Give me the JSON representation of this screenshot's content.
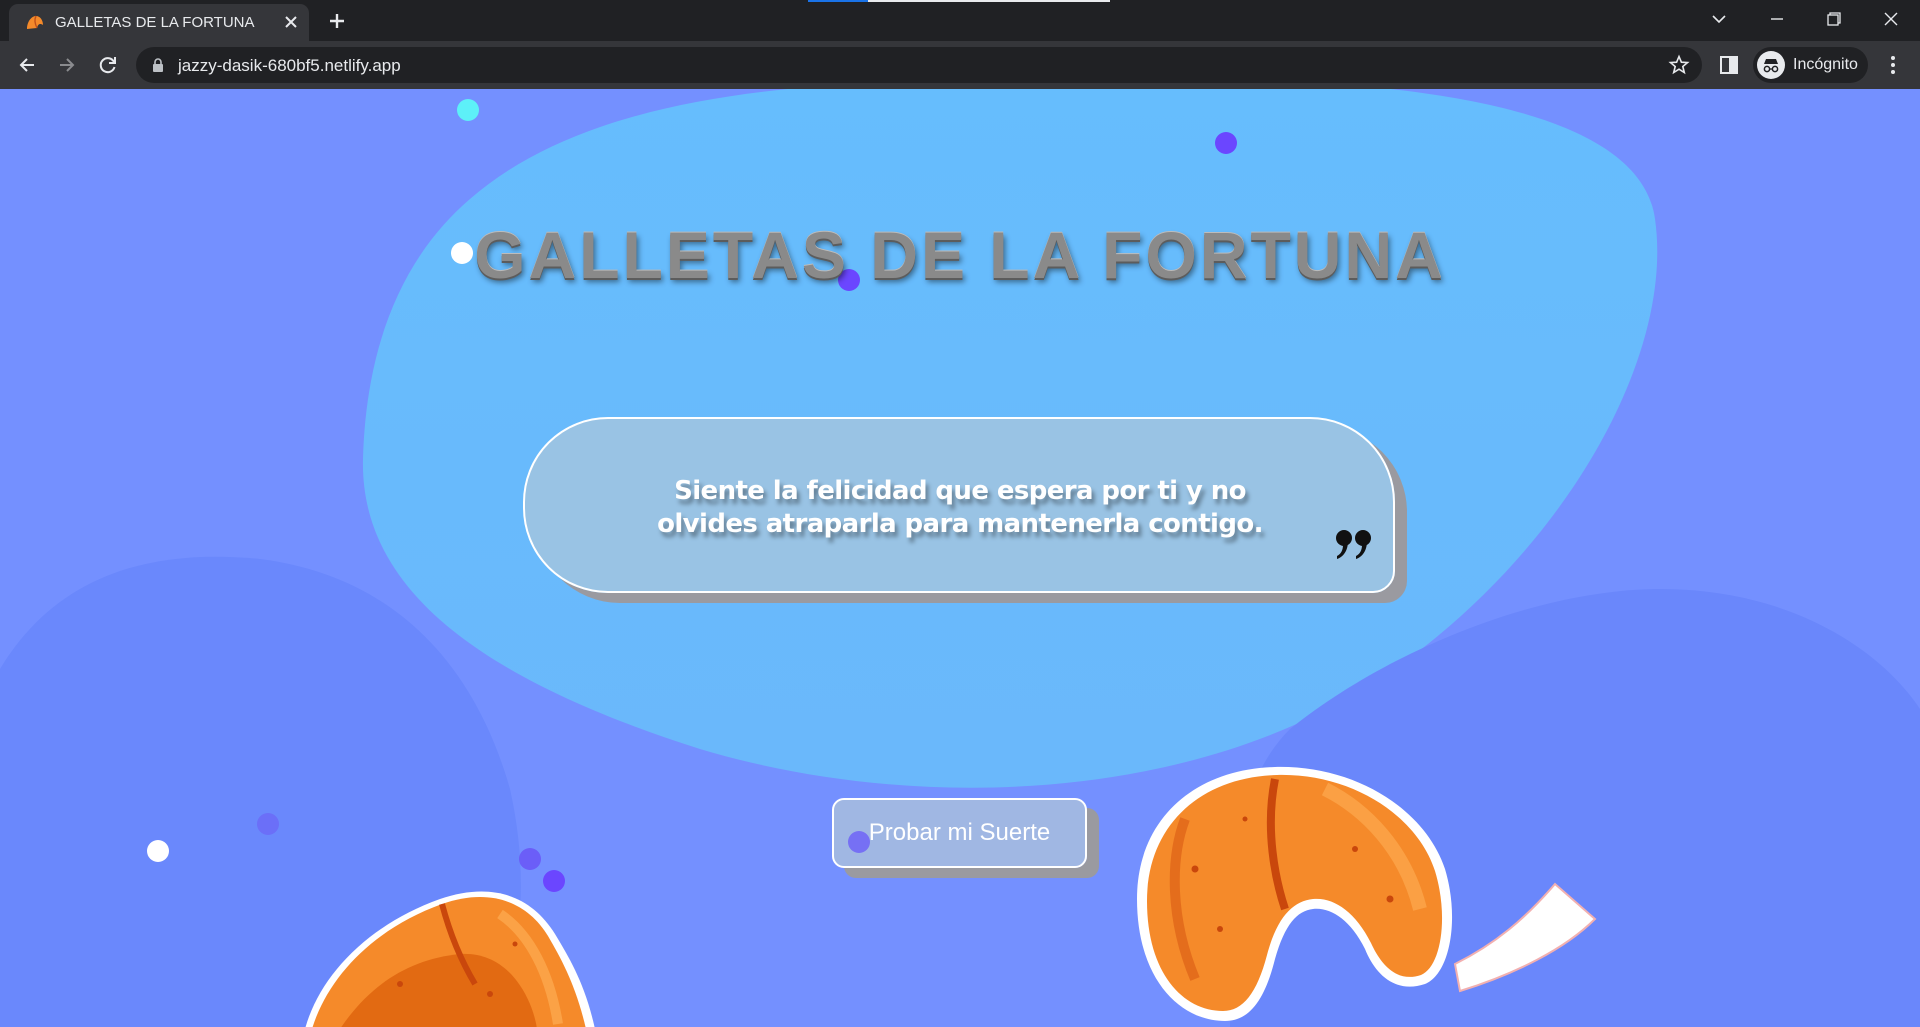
{
  "browser": {
    "tab_title": "GALLETAS DE LA FORTUNA",
    "url": "jazzy-dasik-680bf5.netlify.app",
    "profile_label": "Incógnito"
  },
  "page": {
    "title": "GALLETAS DE LA FORTUNA",
    "quote": "Siente la felicidad que espera por ti y no olvides atraparla para mantenerla contigo.",
    "button_label": "Probar mi Suerte"
  },
  "colors": {
    "background": "#7490ff",
    "blob": "#66bdfd",
    "chrome_dark": "#202124",
    "chrome_tab": "#35363a",
    "cookie_orange": "#f58a2a"
  },
  "icons": [
    "fortune-cookie-favicon",
    "close-icon",
    "plus-icon",
    "chevron-down-icon",
    "minimize-icon",
    "restore-icon",
    "close-window-icon",
    "back-arrow-icon",
    "forward-arrow-icon",
    "reload-icon",
    "lock-icon",
    "star-icon",
    "side-panel-icon",
    "incognito-icon",
    "kebab-menu-icon",
    "quote-mark-icon",
    "fortune-cookie-image"
  ]
}
